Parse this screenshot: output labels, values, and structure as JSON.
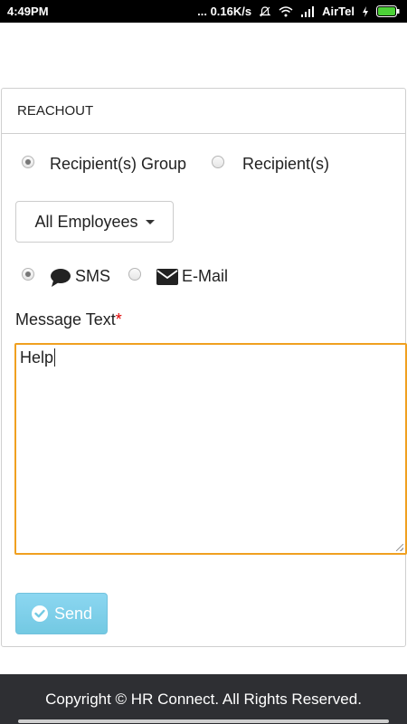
{
  "status_bar": {
    "time": "4:49PM",
    "network_speed": "... 0.16K/s",
    "carrier": "AirTel",
    "icons": [
      "mute-icon",
      "wifi-icon",
      "signal-icon",
      "charging-icon",
      "battery-icon"
    ]
  },
  "panel": {
    "title": "REACHOUT",
    "recipient_options": [
      {
        "label": "Recipient(s) Group",
        "checked": true
      },
      {
        "label": "Recipient(s)",
        "checked": false
      }
    ],
    "group_dropdown": {
      "selected": "All Employees"
    },
    "channel_options": [
      {
        "label": "SMS",
        "icon": "comment-icon",
        "checked": true
      },
      {
        "label": "E-Mail",
        "icon": "envelope-icon",
        "checked": false
      }
    ],
    "message": {
      "label": "Message Text",
      "required_mark": "*",
      "value": "Help"
    },
    "send_button": {
      "label": "Send",
      "icon": "check-circle-icon"
    }
  },
  "footer": {
    "text": "Copyright © HR Connect. All Rights Reserved."
  },
  "colors": {
    "focus_border": "#f0a020",
    "send_button": "#5bc0de",
    "footer_bg": "#2e2f33",
    "required": "#e00000"
  }
}
